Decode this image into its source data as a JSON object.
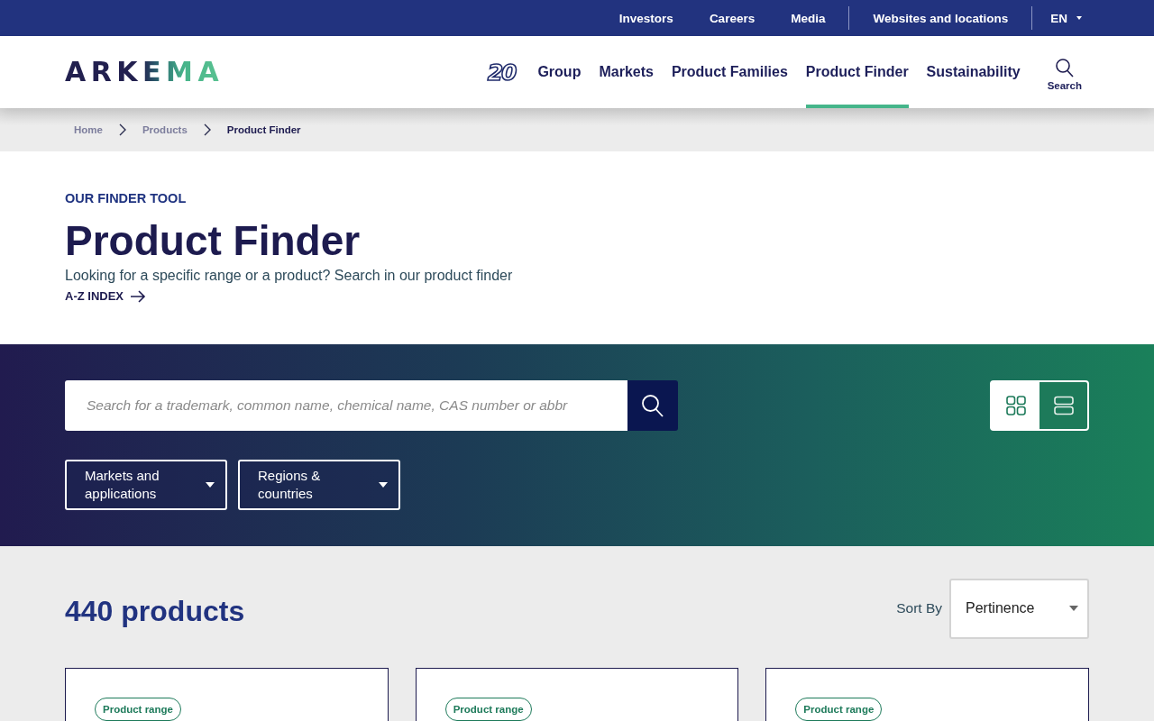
{
  "top_bar": {
    "links": [
      {
        "label": "Investors"
      },
      {
        "label": "Careers"
      },
      {
        "label": "Media"
      },
      {
        "label": "Websites and locations"
      }
    ],
    "language": "EN"
  },
  "header": {
    "logo": "ARKEMA",
    "anniversary_badge": "20",
    "nav": [
      {
        "label": "Group",
        "selected": false
      },
      {
        "label": "Markets",
        "selected": false
      },
      {
        "label": "Product Families",
        "selected": false
      },
      {
        "label": "Product Finder",
        "selected": true
      },
      {
        "label": "Sustainability",
        "selected": false
      }
    ],
    "search_label": "Search"
  },
  "breadcrumb": [
    {
      "label": "Home",
      "current": false
    },
    {
      "label": "Products",
      "current": false
    },
    {
      "label": "Product Finder",
      "current": true
    }
  ],
  "hero": {
    "eyebrow": "OUR FINDER TOOL",
    "title": "Product Finder",
    "subtitle": "Looking for a specific range or a product? Search in our product finder",
    "index_link": "A-Z INDEX"
  },
  "search": {
    "placeholder": "Search for a trademark, common name, chemical name, CAS number or abbr"
  },
  "view_toggle": [
    {
      "kind": "grid",
      "selected": false
    },
    {
      "kind": "list",
      "selected": true
    }
  ],
  "filters": [
    {
      "label": "Markets and applications"
    },
    {
      "label": "Regions & countries"
    }
  ],
  "results": {
    "count": "440 products",
    "sort_label": "Sort By",
    "sort_value": "Pertinence"
  },
  "cards": [
    {
      "badge": "Product range"
    },
    {
      "badge": "Product range"
    },
    {
      "badge": "Product range"
    }
  ]
}
